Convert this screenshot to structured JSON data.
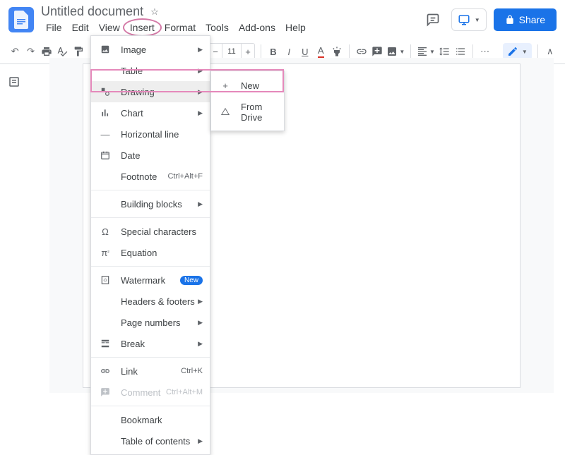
{
  "header": {
    "title": "Untitled document",
    "share_label": "Share"
  },
  "menubar": {
    "items": [
      "File",
      "Edit",
      "View",
      "Insert",
      "Format",
      "Tools",
      "Add-ons",
      "Help"
    ],
    "highlighted_index": 3
  },
  "toolbar": {
    "font_size": "11"
  },
  "insert_menu": {
    "items": [
      {
        "icon": "image",
        "label": "Image",
        "arrow": true
      },
      {
        "icon": "table",
        "label": "Table",
        "arrow": true
      },
      {
        "icon": "drawing",
        "label": "Drawing",
        "arrow": true,
        "highlighted": true
      },
      {
        "icon": "chart",
        "label": "Chart",
        "arrow": true
      },
      {
        "icon": "hr",
        "label": "Horizontal line"
      },
      {
        "icon": "date",
        "label": "Date"
      },
      {
        "icon": "",
        "label": "Footnote",
        "shortcut": "Ctrl+Alt+F"
      },
      {
        "divider": true
      },
      {
        "icon": "",
        "label": "Building blocks",
        "arrow": true
      },
      {
        "divider": true
      },
      {
        "icon": "omega",
        "label": "Special characters"
      },
      {
        "icon": "pi",
        "label": "Equation"
      },
      {
        "divider": true
      },
      {
        "icon": "watermark",
        "label": "Watermark",
        "badge": "New"
      },
      {
        "icon": "",
        "label": "Headers & footers",
        "arrow": true
      },
      {
        "icon": "",
        "label": "Page numbers",
        "arrow": true
      },
      {
        "icon": "break",
        "label": "Break",
        "arrow": true
      },
      {
        "divider": true
      },
      {
        "icon": "link",
        "label": "Link",
        "shortcut": "Ctrl+K"
      },
      {
        "icon": "comment",
        "label": "Comment",
        "shortcut": "Ctrl+Alt+M",
        "disabled": true
      },
      {
        "divider": true
      },
      {
        "icon": "",
        "label": "Bookmark"
      },
      {
        "icon": "",
        "label": "Table of contents",
        "arrow": true
      }
    ]
  },
  "drawing_submenu": {
    "items": [
      {
        "icon": "plus",
        "label": "New"
      },
      {
        "icon": "drive",
        "label": "From Drive"
      }
    ]
  }
}
